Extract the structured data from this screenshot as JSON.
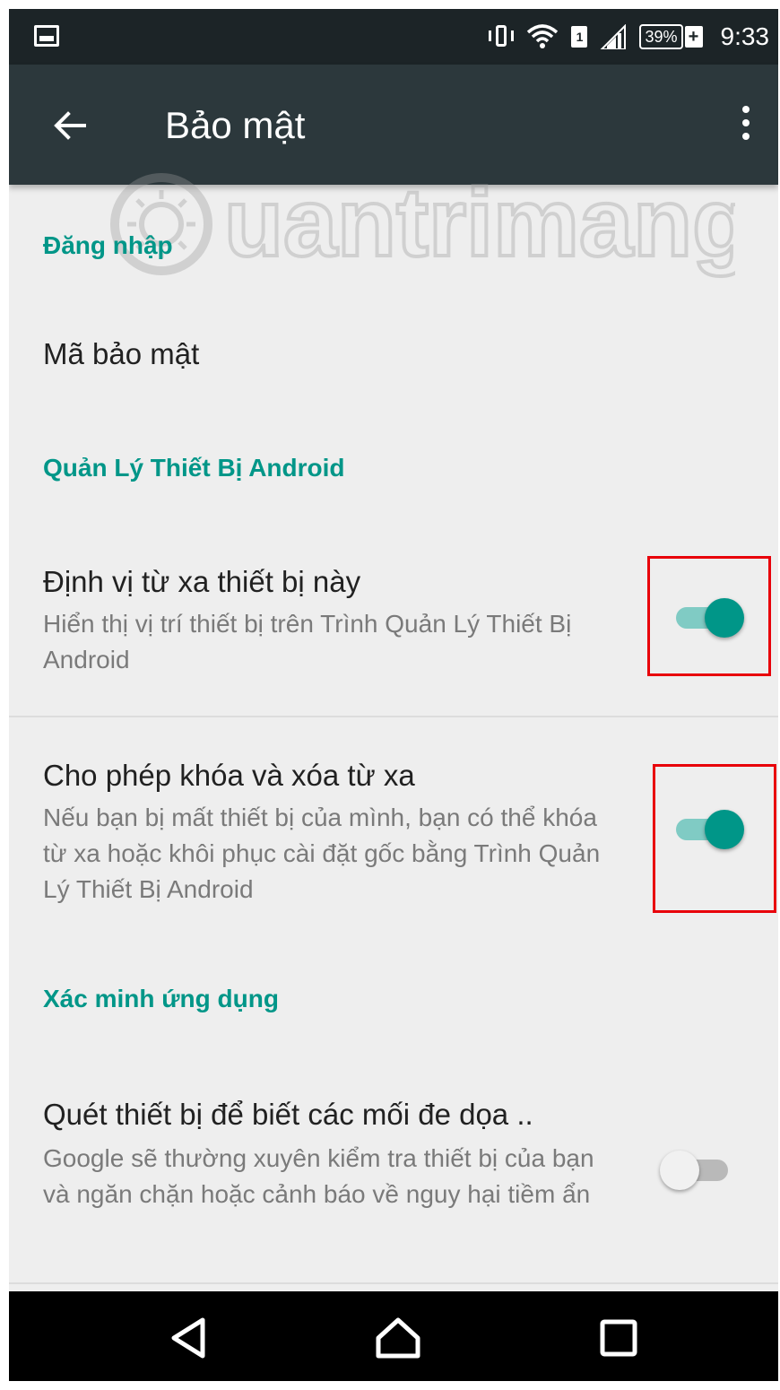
{
  "status_bar": {
    "battery_text": "39%",
    "battery_plus": "+",
    "sim_label": "1",
    "time": "9:33"
  },
  "app_bar": {
    "title": "Bảo mật"
  },
  "sections": [
    {
      "header": "Đăng nhập"
    },
    {
      "header": "Quản Lý Thiết Bị Android"
    },
    {
      "header": "Xác minh ứng dụng"
    }
  ],
  "prefs": [
    {
      "title": "Mã bảo mật"
    },
    {
      "title": "Định vị từ xa thiết bị này",
      "summary": "Hiển thị vị trí thiết bị trên Trình Quản Lý Thiết Bị Android",
      "checked": true
    },
    {
      "title": "Cho phép khóa và xóa từ xa",
      "summary": "Nếu bạn bị mất thiết bị của mình, bạn có thể khóa từ xa hoặc khôi phục cài đặt gốc bằng Trình Quản Lý Thiết Bị Android",
      "checked": true
    },
    {
      "title": "Quét thiết bị để biết các mối đe dọa ..",
      "summary": "Google sẽ thường xuyên kiểm tra thiết bị của bạn và ngăn chặn hoặc cảnh báo về nguy hại tiềm ẩn",
      "checked": false
    }
  ],
  "colors": {
    "accent": "#009688",
    "app_bar": "#2c383c",
    "status_bar": "#1c2427",
    "highlight": "#e8000a"
  },
  "icons": {
    "back": "arrow-back-icon",
    "more": "more-vert-icon",
    "nav_back": "triangle-back-icon",
    "nav_home": "home-icon",
    "nav_recents": "square-recents-icon"
  },
  "watermark": "Quantrimang"
}
